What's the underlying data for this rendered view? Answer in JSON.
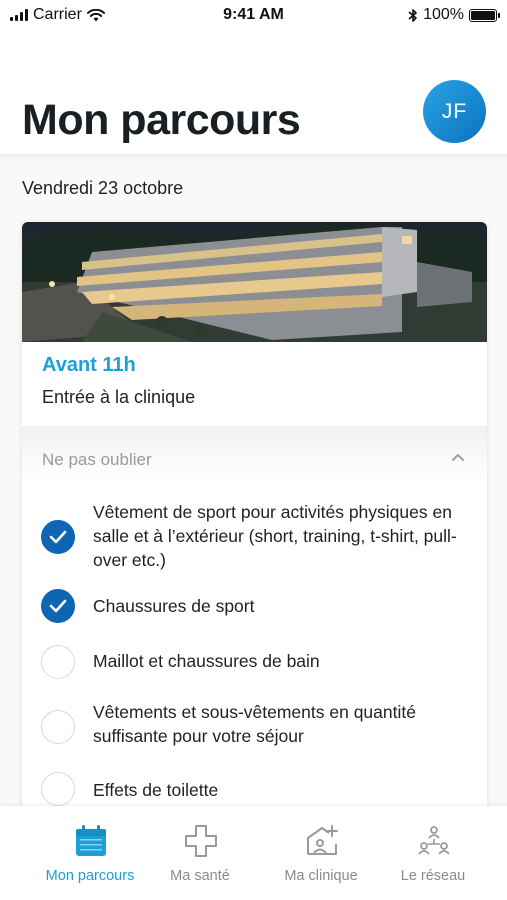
{
  "status_bar": {
    "carrier": "Carrier",
    "time": "9:41 AM",
    "battery": "100%"
  },
  "header": {
    "title": "Mon parcours",
    "avatar_initials": "JF"
  },
  "date": "Vendredi 23 octobre",
  "card": {
    "time": "Avant 11h",
    "subtitle": "Entrée à la clinique",
    "checklist_title": "Ne pas oublier",
    "items": [
      {
        "label": "Vêtement de sport pour activités physiques en salle et à l’extérieur (short, training, t-shirt, pull-over etc.)",
        "checked": true
      },
      {
        "label": "Chaussures de sport",
        "checked": true
      },
      {
        "label": "Maillot et chaussures de bain",
        "checked": false
      },
      {
        "label": "Vêtements et sous-vêtements en quantité suffisante pour votre séjour",
        "checked": false
      },
      {
        "label": "Effets de toilette",
        "checked": false
      }
    ]
  },
  "tabs": [
    {
      "label": "Mon parcours",
      "icon": "calendar-icon",
      "active": true
    },
    {
      "label": "Ma santé",
      "icon": "health-cross-icon",
      "active": false
    },
    {
      "label": "Ma clinique",
      "icon": "clinic-icon",
      "active": false
    },
    {
      "label": "Le réseau",
      "icon": "network-icon",
      "active": false
    }
  ],
  "colors": {
    "accent": "#1ca0d7",
    "check_fill": "#0d65b4",
    "avatar": "#1b8fd6"
  }
}
